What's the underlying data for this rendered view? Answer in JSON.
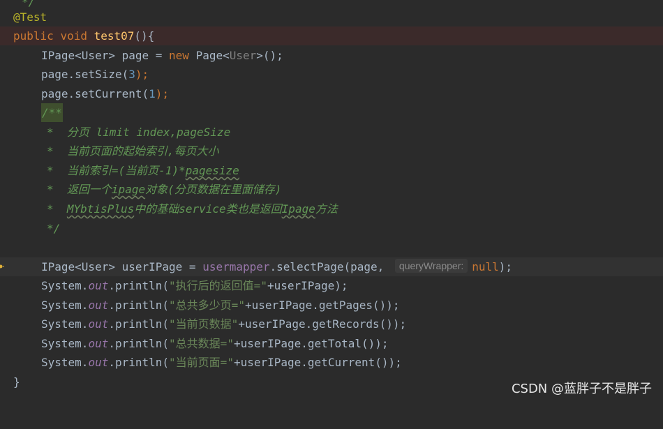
{
  "editor": {
    "top_fragment": "*/",
    "annotation": "@Test",
    "signature": {
      "kw_public": "public",
      "kw_void": "void",
      "method": "test07",
      "rest": "(){"
    },
    "l_ipage": {
      "type1": "IPage<User> page = ",
      "kw_new": "new",
      "type2": " Page<",
      "gen": "User",
      "tail": ">();"
    },
    "l_setsize": {
      "pre": "page.setSize(",
      "num": "3",
      "post": ");"
    },
    "l_setcurrent": {
      "pre": "page.setCurrent(",
      "num": "1",
      "post": ");"
    },
    "doc_open": "/**",
    "doc_lines": [
      {
        "star": "*  ",
        "text": "分页 limit index,pageSize"
      },
      {
        "star": "*  ",
        "text": "当前页面的起始索引,每页大小"
      },
      {
        "star": "*  ",
        "pre": "当前索引=(当前页-1)*",
        "wavy": "pagesize",
        "post": ""
      },
      {
        "star": "*  ",
        "pre": "返回一个",
        "wavy": "ipage",
        "post": "对象(分页数据在里面储存)"
      },
      {
        "star": "*  ",
        "pre": "",
        "wavy": "MYbtisPlus",
        "mid": "中的基础service类也是返回",
        "wavy2": "Ipage",
        "post": "方法"
      }
    ],
    "doc_close": "*/",
    "l_select": {
      "pre": "IPage<User> userIPage = ",
      "field": "usermapper",
      "call": ".selectPage(page, ",
      "hint": "queryWrapper:",
      "kw_null": "null",
      "tail": ");"
    },
    "prints": [
      {
        "sys": "System.",
        "out": "out",
        "call": ".println(",
        "str": "\"执行后的返回值=\"",
        "tail": "+userIPage);"
      },
      {
        "sys": "System.",
        "out": "out",
        "call": ".println(",
        "str": "\"总共多少页=\"",
        "tail": "+userIPage.getPages());"
      },
      {
        "sys": "System.",
        "out": "out",
        "call": ".println(",
        "str": "\"当前页数据\"",
        "tail": "+userIPage.getRecords());"
      },
      {
        "sys": "System.",
        "out": "out",
        "call": ".println(",
        "str": "\"总共数据=\"",
        "tail": "+userIPage.getTotal());"
      },
      {
        "sys": "System.",
        "out": "out",
        "call": ".println(",
        "str": "\"当前页面=\"",
        "tail": "+userIPage.getCurrent());"
      }
    ],
    "closing_brace": "}"
  },
  "watermark": "CSDN @蓝胖子不是胖子",
  "colors": {
    "background": "#2b2b2b",
    "keyword": "#cc7832",
    "annotation": "#bbb529",
    "method": "#ffc66d",
    "number": "#6897bb",
    "string": "#6a8759",
    "field": "#9876aa",
    "doc": "#629755"
  },
  "icons": {
    "gutter": "bulb-icon"
  }
}
